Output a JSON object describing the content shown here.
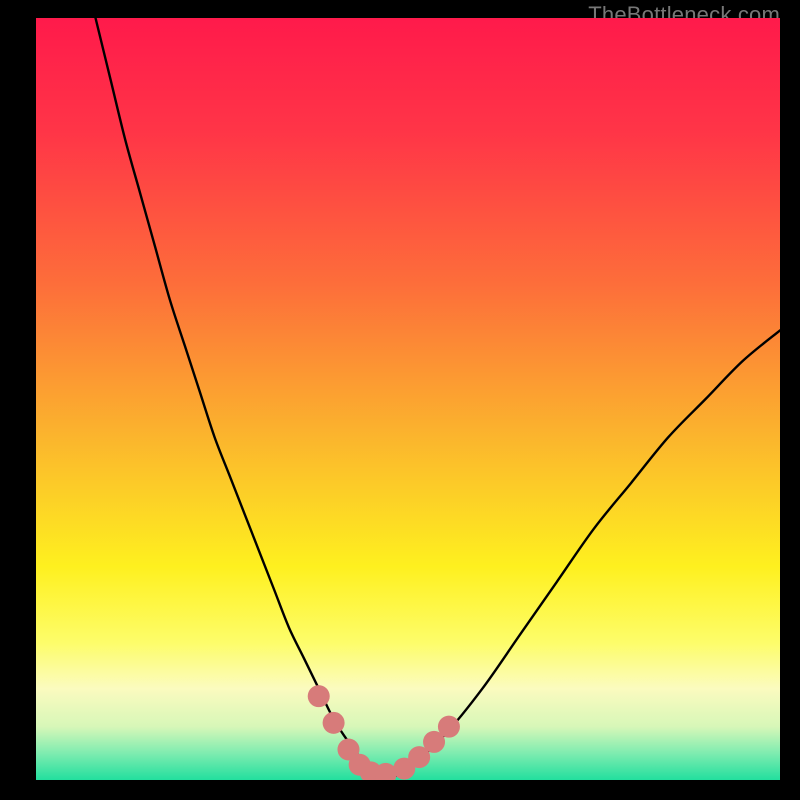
{
  "watermark": "TheBottleneck.com",
  "colors": {
    "frame": "#000000",
    "curve": "#000000",
    "marker": "#d77b7a",
    "gradient_stops": [
      {
        "offset": 0.0,
        "color": "#ff1a4b"
      },
      {
        "offset": 0.15,
        "color": "#ff3547"
      },
      {
        "offset": 0.35,
        "color": "#fd6e3a"
      },
      {
        "offset": 0.55,
        "color": "#fbb52d"
      },
      {
        "offset": 0.72,
        "color": "#fef01f"
      },
      {
        "offset": 0.82,
        "color": "#fdfd6a"
      },
      {
        "offset": 0.88,
        "color": "#fbfbbf"
      },
      {
        "offset": 0.93,
        "color": "#d7f7b8"
      },
      {
        "offset": 0.965,
        "color": "#7eecb0"
      },
      {
        "offset": 1.0,
        "color": "#22df9e"
      }
    ]
  },
  "chart_data": {
    "type": "line",
    "title": "",
    "xlabel": "",
    "ylabel": "",
    "xlim": [
      0,
      100
    ],
    "ylim": [
      0,
      100
    ],
    "series": [
      {
        "name": "bottleneck-curve",
        "x": [
          8,
          10,
          12,
          14,
          16,
          18,
          20,
          22,
          24,
          26,
          28,
          30,
          32,
          34,
          36,
          38,
          40,
          42,
          44,
          46,
          48,
          50,
          55,
          60,
          65,
          70,
          75,
          80,
          85,
          90,
          95,
          100
        ],
        "values": [
          100,
          92,
          84,
          77,
          70,
          63,
          57,
          51,
          45,
          40,
          35,
          30,
          25,
          20,
          16,
          12,
          8,
          5,
          2.5,
          1,
          0.5,
          1.5,
          6,
          12,
          19,
          26,
          33,
          39,
          45,
          50,
          55,
          59
        ]
      }
    ],
    "markers": {
      "name": "highlight-dots",
      "x": [
        38,
        40,
        42,
        43.5,
        45,
        47,
        49.5,
        51.5,
        53.5,
        55.5
      ],
      "values": [
        11,
        7.5,
        4,
        2,
        1,
        0.8,
        1.5,
        3,
        5,
        7
      ]
    }
  }
}
